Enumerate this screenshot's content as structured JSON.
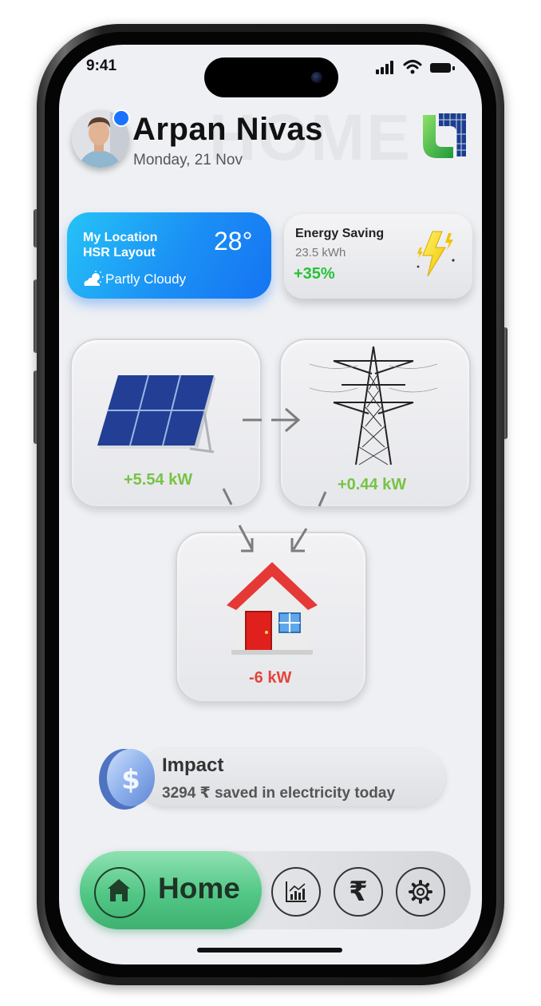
{
  "status_bar": {
    "time": "9:41"
  },
  "header": {
    "ghost_word": "HOME",
    "user_name": "Arpan Nivas",
    "date": "Monday, 21 Nov"
  },
  "weather": {
    "location_label": "My Location",
    "location_name": "HSR Layout",
    "temperature": "28°",
    "condition": "Partly Cloudy"
  },
  "energy": {
    "title": "Energy Saving",
    "value": "23.5 kWh",
    "percent": "+35%"
  },
  "flow": {
    "solar_power": "+5.54 kW",
    "grid_power": "+0.44 kW",
    "home_power": "-6 kW"
  },
  "impact": {
    "title": "Impact",
    "text": "3294 ₹ saved in electricity today"
  },
  "nav": {
    "home_label": "Home",
    "rupee_glyph": "₹",
    "icons": [
      "home-icon",
      "stats-icon",
      "rupee-icon",
      "settings-icon"
    ]
  },
  "colors": {
    "accent_blue": "#1b8ff5",
    "positive_green": "#76c345",
    "saving_green": "#27c23a",
    "negative_red": "#e5433b",
    "nav_green": "#52c785",
    "screen_bg": "#eff0f4"
  }
}
